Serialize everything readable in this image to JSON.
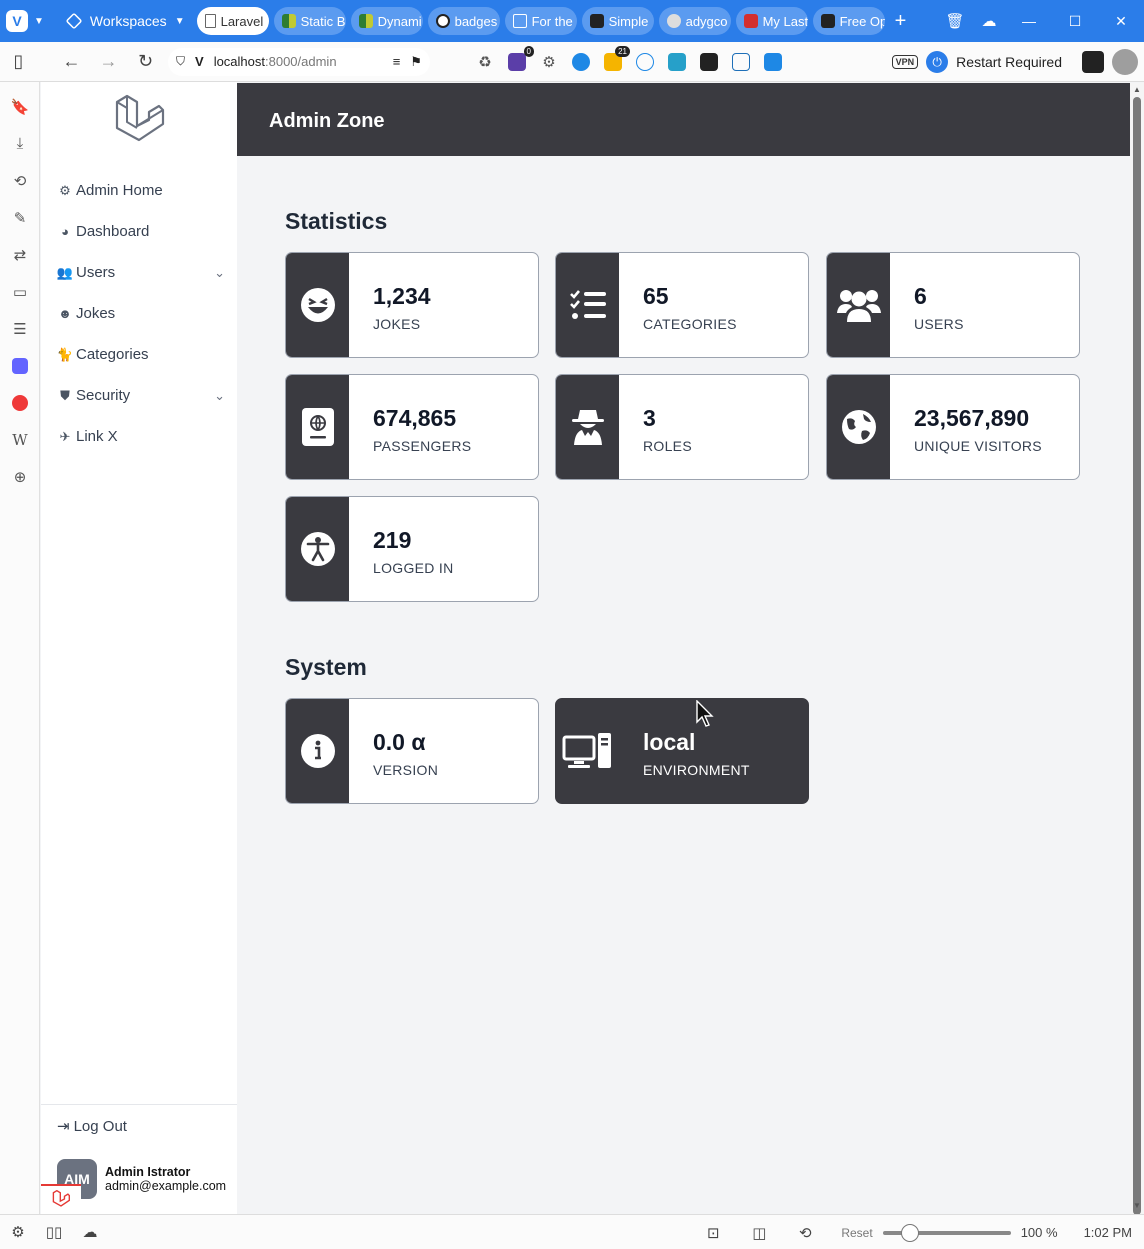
{
  "browser": {
    "workspaces_label": "Workspaces",
    "tabs": [
      {
        "label": "Laravel",
        "icon": "doc-icon",
        "active": true
      },
      {
        "label": "Static B",
        "icon": "green-icon"
      },
      {
        "label": "Dynami",
        "icon": "green-icon"
      },
      {
        "label": "badges",
        "icon": "github-icon"
      },
      {
        "label": "For the",
        "icon": "fb-icon"
      },
      {
        "label": "Simple",
        "icon": "s-icon"
      },
      {
        "label": "adygco",
        "icon": "avatar-icon"
      },
      {
        "label": "My Last",
        "icon": "red-icon"
      },
      {
        "label": "Free Op",
        "icon": "ui-icon"
      }
    ],
    "url_host": "localhost",
    "url_path": ":8000/admin",
    "ext_badges": {
      "one": "0",
      "two": "21"
    },
    "vpn_label": "VPN",
    "restart_label": "Restart Required",
    "status": {
      "reset": "Reset",
      "zoom": "100 %",
      "time": "1:02 PM"
    },
    "accent": "#2b7de9"
  },
  "sidebar": {
    "items": [
      {
        "label": "Admin Home",
        "icon": "gear-icon"
      },
      {
        "label": "Dashboard",
        "icon": "palette-icon"
      },
      {
        "label": "Users",
        "icon": "users-icon",
        "expandable": true
      },
      {
        "label": "Jokes",
        "icon": "laugh-icon"
      },
      {
        "label": "Categories",
        "icon": "cat-icon"
      },
      {
        "label": "Security",
        "icon": "shield-icon",
        "expandable": true
      },
      {
        "label": "Link X",
        "icon": "plane-icon"
      }
    ],
    "logout_label": "Log Out",
    "user": {
      "initials": "AIM",
      "name": "Admin Istrator",
      "email": "admin@example.com"
    }
  },
  "header": {
    "title": "Admin Zone"
  },
  "statistics": {
    "title": "Statistics",
    "cards": [
      {
        "value": "1,234",
        "label": "JOKES",
        "icon": "laugh-squint-icon"
      },
      {
        "value": "65",
        "label": "CATEGORIES",
        "icon": "list-check-icon"
      },
      {
        "value": "6",
        "label": "USERS",
        "icon": "users-icon"
      },
      {
        "value": "674,865",
        "label": "PASSENGERS",
        "icon": "passport-icon"
      },
      {
        "value": "3",
        "label": "ROLES",
        "icon": "user-secret-icon"
      },
      {
        "value": "23,567,890",
        "label": "UNIQUE VISITORS",
        "icon": "globe-icon"
      },
      {
        "value": "219",
        "label": "LOGGED IN",
        "icon": "universal-access-icon"
      }
    ]
  },
  "system": {
    "title": "System",
    "cards": [
      {
        "value": "0.0 α",
        "label": "VERSION",
        "icon": "info-icon"
      },
      {
        "value": "local",
        "label": "ENVIRONMENT",
        "icon": "computer-icon"
      }
    ]
  },
  "colors": {
    "card_dark": "#3a3a40",
    "background": "#f3f4f6"
  }
}
